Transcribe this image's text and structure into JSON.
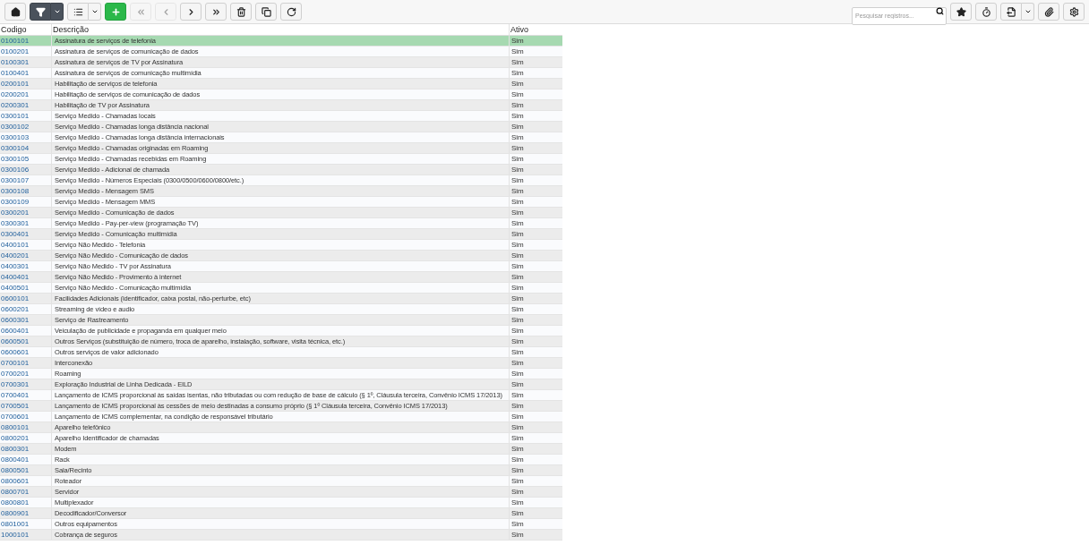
{
  "toolbar": {
    "left": [
      {
        "kind": "home",
        "disabled": false,
        "active": false
      },
      {
        "kind": "filter",
        "disabled": false,
        "active": true,
        "dropdown": true
      },
      {
        "kind": "list",
        "disabled": false,
        "active": false,
        "dropdown": true
      },
      {
        "kind": "add",
        "disabled": false,
        "active": false
      },
      {
        "kind": "first",
        "disabled": true,
        "active": false
      },
      {
        "kind": "previous",
        "disabled": true,
        "active": false
      },
      {
        "kind": "next",
        "disabled": false,
        "active": false
      },
      {
        "kind": "last",
        "disabled": false,
        "active": false
      },
      {
        "kind": "delete",
        "disabled": false,
        "active": false
      },
      {
        "kind": "copy",
        "disabled": false,
        "active": false
      },
      {
        "kind": "refresh",
        "disabled": false,
        "active": false
      }
    ],
    "search": {
      "placeholder": "Pesquisar registros..."
    },
    "right": [
      {
        "kind": "favorite",
        "disabled": false,
        "active": false
      },
      {
        "kind": "timer",
        "disabled": false,
        "active": false
      },
      {
        "kind": "export",
        "disabled": false,
        "active": false,
        "dropdown": true
      },
      {
        "kind": "attach",
        "disabled": false,
        "active": false
      },
      {
        "kind": "settings",
        "disabled": false,
        "active": false
      }
    ]
  },
  "table": {
    "columns": [
      "Codigo",
      "Descrição",
      "Ativo"
    ],
    "rows": [
      {
        "code": "0100101",
        "description": "Assinatura de serviços de telefonia",
        "active": "Sim",
        "selected": true
      },
      {
        "code": "0100201",
        "description": "Assinatura de serviços de comunicação de dados",
        "active": "Sim",
        "selected": false
      },
      {
        "code": "0100301",
        "description": "Assinatura de serviços de TV por Assinatura",
        "active": "Sim",
        "selected": false
      },
      {
        "code": "0100401",
        "description": "Assinatura de serviços de comunicação multimídia",
        "active": "Sim",
        "selected": false
      },
      {
        "code": "0200101",
        "description": "Habilitação de serviços de telefonia",
        "active": "Sim",
        "selected": false
      },
      {
        "code": "0200201",
        "description": "Habilitação de serviços de comunicação de dados",
        "active": "Sim",
        "selected": false
      },
      {
        "code": "0200301",
        "description": "Habilitação de TV por Assinatura",
        "active": "Sim",
        "selected": false
      },
      {
        "code": "0300101",
        "description": "Serviço Medido - Chamadas locais",
        "active": "Sim",
        "selected": false
      },
      {
        "code": "0300102",
        "description": "Serviço Medido - Chamadas longa distância nacional",
        "active": "Sim",
        "selected": false
      },
      {
        "code": "0300103",
        "description": "Serviço Medido - Chamadas longa distância internacionais",
        "active": "Sim",
        "selected": false
      },
      {
        "code": "0300104",
        "description": "Serviço Medido - Chamadas originadas em Roaming",
        "active": "Sim",
        "selected": false
      },
      {
        "code": "0300105",
        "description": "Serviço Medido - Chamadas recebidas em Roaming",
        "active": "Sim",
        "selected": false
      },
      {
        "code": "0300106",
        "description": "Serviço Medido - Adicional de chamada",
        "active": "Sim",
        "selected": false
      },
      {
        "code": "0300107",
        "description": "Serviço Medido - Números Especiais (0300/0500/0600/0800/etc.)",
        "active": "Sim",
        "selected": false
      },
      {
        "code": "0300108",
        "description": "Serviço Medido - Mensagem SMS",
        "active": "Sim",
        "selected": false
      },
      {
        "code": "0300109",
        "description": "Serviço Medido - Mensagem MMS",
        "active": "Sim",
        "selected": false
      },
      {
        "code": "0300201",
        "description": "Serviço Medido - Comunicação de dados",
        "active": "Sim",
        "selected": false
      },
      {
        "code": "0300301",
        "description": "Serviço Medido - Pay-per-view (programação TV)",
        "active": "Sim",
        "selected": false
      },
      {
        "code": "0300401",
        "description": "Serviço Medido - Comunicação multimídia",
        "active": "Sim",
        "selected": false
      },
      {
        "code": "0400101",
        "description": "Serviço Não Medido - Telefonia",
        "active": "Sim",
        "selected": false
      },
      {
        "code": "0400201",
        "description": "Serviço Não Medido - Comunicação de dados",
        "active": "Sim",
        "selected": false
      },
      {
        "code": "0400301",
        "description": "Serviço Não Medido - TV por Assinatura",
        "active": "Sim",
        "selected": false
      },
      {
        "code": "0400401",
        "description": "Serviço Não Medido - Provimento à internet",
        "active": "Sim",
        "selected": false
      },
      {
        "code": "0400501",
        "description": "Serviço Não Medido - Comunicação multimídia",
        "active": "Sim",
        "selected": false
      },
      {
        "code": "0600101",
        "description": "Facilidades Adicionais (identificador, caixa postal, não-perturbe, etc)",
        "active": "Sim",
        "selected": false
      },
      {
        "code": "0600201",
        "description": "Streaming de vídeo e audio",
        "active": "Sim",
        "selected": false
      },
      {
        "code": "0600301",
        "description": "Serviço de Rastreamento",
        "active": "Sim",
        "selected": false
      },
      {
        "code": "0600401",
        "description": "Veiculação de publicidade e propaganda em qualquer meio",
        "active": "Sim",
        "selected": false
      },
      {
        "code": "0600501",
        "description": "Outros Serviços (substituição de número, troca de aparelho, instalação, software, visita técnica, etc.)",
        "active": "Sim",
        "selected": false
      },
      {
        "code": "0600601",
        "description": "Outros serviços de valor adicionado",
        "active": "Sim",
        "selected": false
      },
      {
        "code": "0700101",
        "description": "Interconexão",
        "active": "Sim",
        "selected": false
      },
      {
        "code": "0700201",
        "description": "Roaming",
        "active": "Sim",
        "selected": false
      },
      {
        "code": "0700301",
        "description": "Exploração Industrial de Linha Dedicada - EILD",
        "active": "Sim",
        "selected": false
      },
      {
        "code": "0700401",
        "description": "Lançamento de ICMS proporcional às saídas isentas, não tributadas ou com redução de base de cálculo (§ 1º, Cláusula terceira, Convênio ICMS 17/2013)",
        "active": "Sim",
        "selected": false
      },
      {
        "code": "0700501",
        "description": "Lançamento de ICMS proporcional às cessões de meio destinadas a consumo próprio (§ 1º Cláusula terceira, Convênio ICMS 17/2013)",
        "active": "Sim",
        "selected": false
      },
      {
        "code": "0700601",
        "description": "Lançamento de ICMS complementar, na condição de responsável tributário",
        "active": "Sim",
        "selected": false
      },
      {
        "code": "0800101",
        "description": "Aparelho telefônico",
        "active": "Sim",
        "selected": false
      },
      {
        "code": "0800201",
        "description": "Aparelho Identificador de chamadas",
        "active": "Sim",
        "selected": false
      },
      {
        "code": "0800301",
        "description": "Modem",
        "active": "Sim",
        "selected": false
      },
      {
        "code": "0800401",
        "description": "Rack",
        "active": "Sim",
        "selected": false
      },
      {
        "code": "0800501",
        "description": "Sala/Recinto",
        "active": "Sim",
        "selected": false
      },
      {
        "code": "0800601",
        "description": "Roteador",
        "active": "Sim",
        "selected": false
      },
      {
        "code": "0800701",
        "description": "Servidor",
        "active": "Sim",
        "selected": false
      },
      {
        "code": "0800801",
        "description": "Multiplexador",
        "active": "Sim",
        "selected": false
      },
      {
        "code": "0800901",
        "description": "Decodificador/Conversor",
        "active": "Sim",
        "selected": false
      },
      {
        "code": "0801001",
        "description": "Outros equipamentos",
        "active": "Sim",
        "selected": false
      },
      {
        "code": "1000101",
        "description": "Cobrança de seguros",
        "active": "Sim",
        "selected": false
      }
    ]
  }
}
